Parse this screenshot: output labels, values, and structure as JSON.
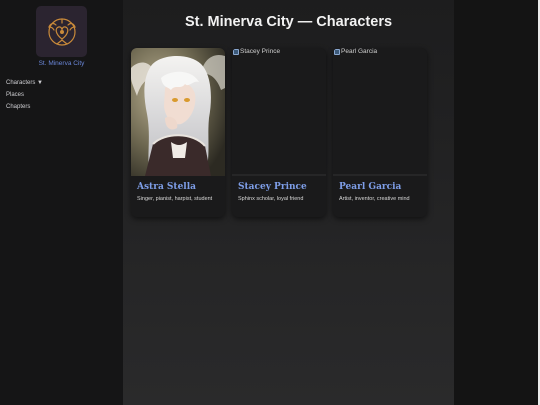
{
  "sidebar": {
    "site_name": "St. Minerva City",
    "logo_icon": "winged-heart-crest-icon",
    "nav_items": [
      {
        "label": "Characters ▼"
      },
      {
        "label": "Places"
      },
      {
        "label": "Chapters"
      }
    ]
  },
  "main": {
    "title": "St. Minerva City — Characters",
    "cards": [
      {
        "name": "Astra Stella",
        "description": "Singer, pianist, harpist, student",
        "image": "portrait"
      },
      {
        "name": "Stacey Prince",
        "description": "Sphinx scholar, loyal friend",
        "image_alt": "Stacey Prince",
        "image": "broken"
      },
      {
        "name": "Pearl Garcia",
        "description": "Artist, inventor, creative mind",
        "image_alt": "Pearl Garcia",
        "image": "broken"
      }
    ]
  },
  "colors": {
    "accent": "#7e9ee8",
    "logo_gold": "#c98a3a",
    "sidebar_bg": "#151516",
    "main_bg": "#222223"
  }
}
